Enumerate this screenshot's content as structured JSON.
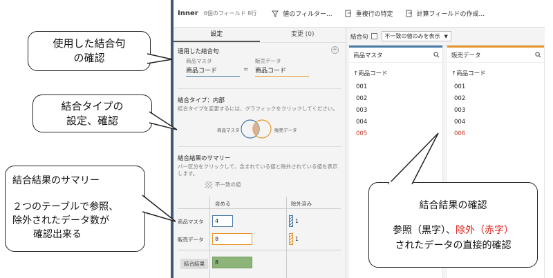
{
  "toolbar": {
    "step_name": "Inner",
    "meta": "6個のフィールド  8行",
    "filter_label": "値のフィルター...",
    "dup_label": "重複行の特定",
    "calc_label": "計算フィールドの作成..."
  },
  "settings": {
    "tabs": [
      "設定",
      "変更 (0)"
    ],
    "applied_join_title": "適用した結合句",
    "left_table": "商品マスタ",
    "right_table": "販売データ",
    "left_field": "商品コード",
    "right_field": "商品コード",
    "equals": "=",
    "join_type_title": "結合タイプ：内部",
    "join_type_desc": "結合タイプを変更するには、グラフィックをクリックしてください。",
    "venn_left": "商品マスタ",
    "venn_right": "販売データ",
    "summary_title": "結合結果のサマリー",
    "summary_desc": "バー区分をクリックして、含まれている値と除外されている値を表示します。",
    "mismatch_label": "不一致の値",
    "col_included": "含める",
    "col_excluded": "除外済み",
    "rows": [
      {
        "label": "商品マスタ",
        "included": "4",
        "excluded": "1"
      },
      {
        "label": "販売データ",
        "included": "8",
        "excluded": "1"
      }
    ],
    "result_label": "結合結果",
    "result_value": "8"
  },
  "grid": {
    "join_clause_label": "結合句",
    "filter_select": "不一致の値のみを表示",
    "columns": [
      {
        "table": "商品マスタ",
        "field": "↑商品コード",
        "values": [
          "001",
          "002",
          "003",
          "004",
          "005"
        ],
        "excluded_index": 4
      },
      {
        "table": "販売データ",
        "field": "↑商品コード",
        "values": [
          "001",
          "002",
          "003",
          "004",
          "006"
        ],
        "excluded_index": 4
      }
    ]
  },
  "callouts": {
    "c1": [
      "使用した結合句",
      "の確認"
    ],
    "c2": [
      "結合タイプの",
      "設定、確認"
    ],
    "c3": {
      "title": "結合結果のサマリー",
      "body": [
        "２つのテーブルで参照、",
        "除外されたデータ数が",
        "確認出来る"
      ]
    },
    "c4": {
      "title": "結合結果の確認",
      "line1_a": "参照（黒字）、",
      "line1_b": "除外（赤字）",
      "line2": "されたデータの直接的確認"
    }
  },
  "colors": {
    "left_table": "#4a7aa6",
    "right_table": "#e8952a",
    "result": "#8db57a",
    "excluded_text": "#c0392b",
    "callout_red": "#e0201b"
  }
}
